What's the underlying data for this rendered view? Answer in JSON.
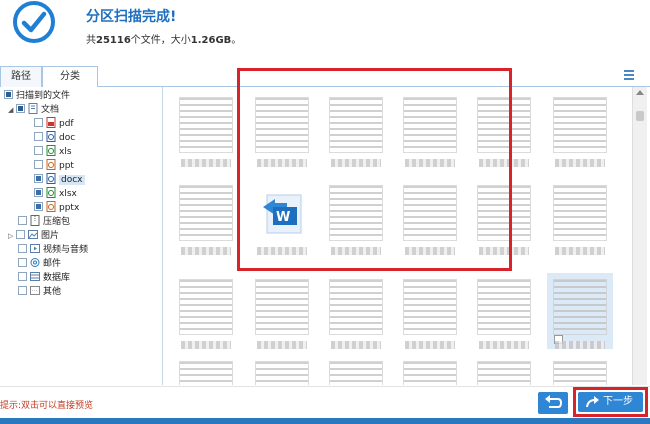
{
  "header": {
    "title": "分区扫描完成!",
    "summary_prefix": "共",
    "file_count": "25116",
    "summary_middle": "个文件，大小",
    "total_size": "1.26GB",
    "summary_suffix": "。"
  },
  "tabs": [
    {
      "label": "路径",
      "active": false
    },
    {
      "label": "分类",
      "active": true
    }
  ],
  "tree": {
    "root": "扫描到的文件",
    "documents": {
      "label": "文档",
      "children": [
        "pdf",
        "doc",
        "xls",
        "ppt",
        "docx",
        "xlsx",
        "pptx"
      ],
      "selected": "docx"
    },
    "categories": [
      "压缩包",
      "图片",
      "视频与音频",
      "邮件",
      "数据库",
      "其他"
    ]
  },
  "colors": {
    "accent": "#2f86d4",
    "highlight": "#d8232a",
    "hint_text": "#c23b22"
  },
  "footer": {
    "hint": "提示:双击可以直接预览",
    "next_label": "下一步",
    "back_icon": "undo-arrow-icon",
    "next_icon": "forward-arrow-icon"
  }
}
